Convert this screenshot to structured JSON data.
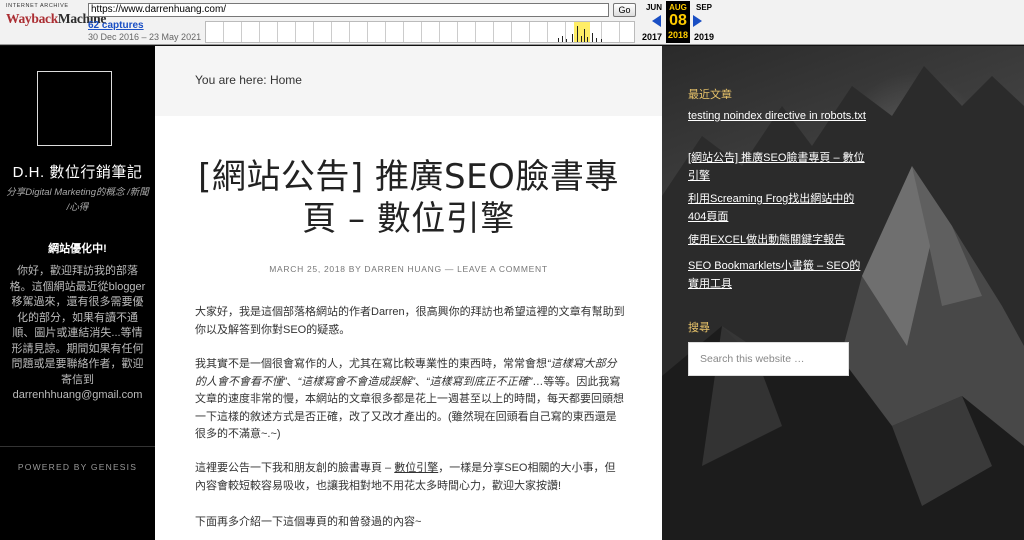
{
  "wayback": {
    "logo_top": "INTERNET ARCHIVE",
    "logo_brand_1": "Wayback",
    "logo_brand_2": "Machine",
    "url": "https://www.darrenhuang.com/",
    "go_label": "Go",
    "captures_label": "62 captures",
    "date_range": "30 Dec 2016 – 23 May 2021",
    "calendar": {
      "prev_month": "JUN",
      "current_month": "AUG",
      "next_month": "SEP",
      "current_day": "08",
      "prev_year": "2017",
      "current_year": "2018",
      "next_year": "2019"
    }
  },
  "sidebar_left": {
    "site_title": "D.H. 數位行銷筆記",
    "site_description": "分享Digital Marketing的概念 /新聞 /心得",
    "widget_title": "網站優化中!",
    "widget_text": "你好，歡迎拜訪我的部落格。這個網站最近從blogger移駕過來，還有很多需要優化的部分，如果有讀不通順、圖片或連結消失...等情形請見諒。期間如果有任何問題或是要聯絡作者，歡迎寄信到 darrenhhuang@gmail.com",
    "powered_by": "POWERED BY GENESIS"
  },
  "main": {
    "breadcrumb": "You are here: Home",
    "post_title": "[網站公告] 推廣SEO臉書專頁 – 數位引擎",
    "post_meta": "MARCH 25, 2018 BY DARREN HUANG — LEAVE A COMMENT",
    "p1": "大家好，我是這個部落格網站的作者Darren，很高興你的拜訪也希望這裡的文章有幫助到你以及解答到你對SEO的疑惑。",
    "p2_a": "我其實不是一個很會寫作的人，尤其在寫比較專業性的東西時，常常會想",
    "p2_em1": "“這樣寫大部分的人會不會看不懂”",
    "p2_sep1": "、",
    "p2_em2": "“這樣寫會不會造成誤解”",
    "p2_sep2": "、",
    "p2_em3": "“這樣寫到底正不正確”",
    "p2_b": "…等等。因此我寫文章的速度非常的慢，本網站的文章很多都是花上一週甚至以上的時間，每天都要回頭想一下這樣的敘述方式是否正確，改了又改才產出的。(雖然現在回頭看自己寫的東西還是很多的不滿意~.~)",
    "p3_a": "這裡要公告一下我和朋友創的臉書專頁 – ",
    "p3_link": "數位引擎",
    "p3_b": "，一樣是分享SEO相關的大小事，但內容會較短較容易吸收，也讓我相對地不用花太多時間心力，歡迎大家按讚!",
    "p4": "下面再多介紹一下這個專頁的和曾發過的內容~"
  },
  "sidebar_right": {
    "recent_title": "最近文章",
    "recent_posts": [
      "testing noindex directive in robots.txt",
      "[網站公告] 推廣SEO臉書專頁 – 數位引擎",
      "利用Screaming Frog找出網站中的404頁面",
      "使用EXCEL做出動態關鍵字報告",
      "SEO Bookmarklets小書籤 – SEO的實用工具"
    ],
    "search_title": "搜尋",
    "search_placeholder": "Search this website …"
  }
}
